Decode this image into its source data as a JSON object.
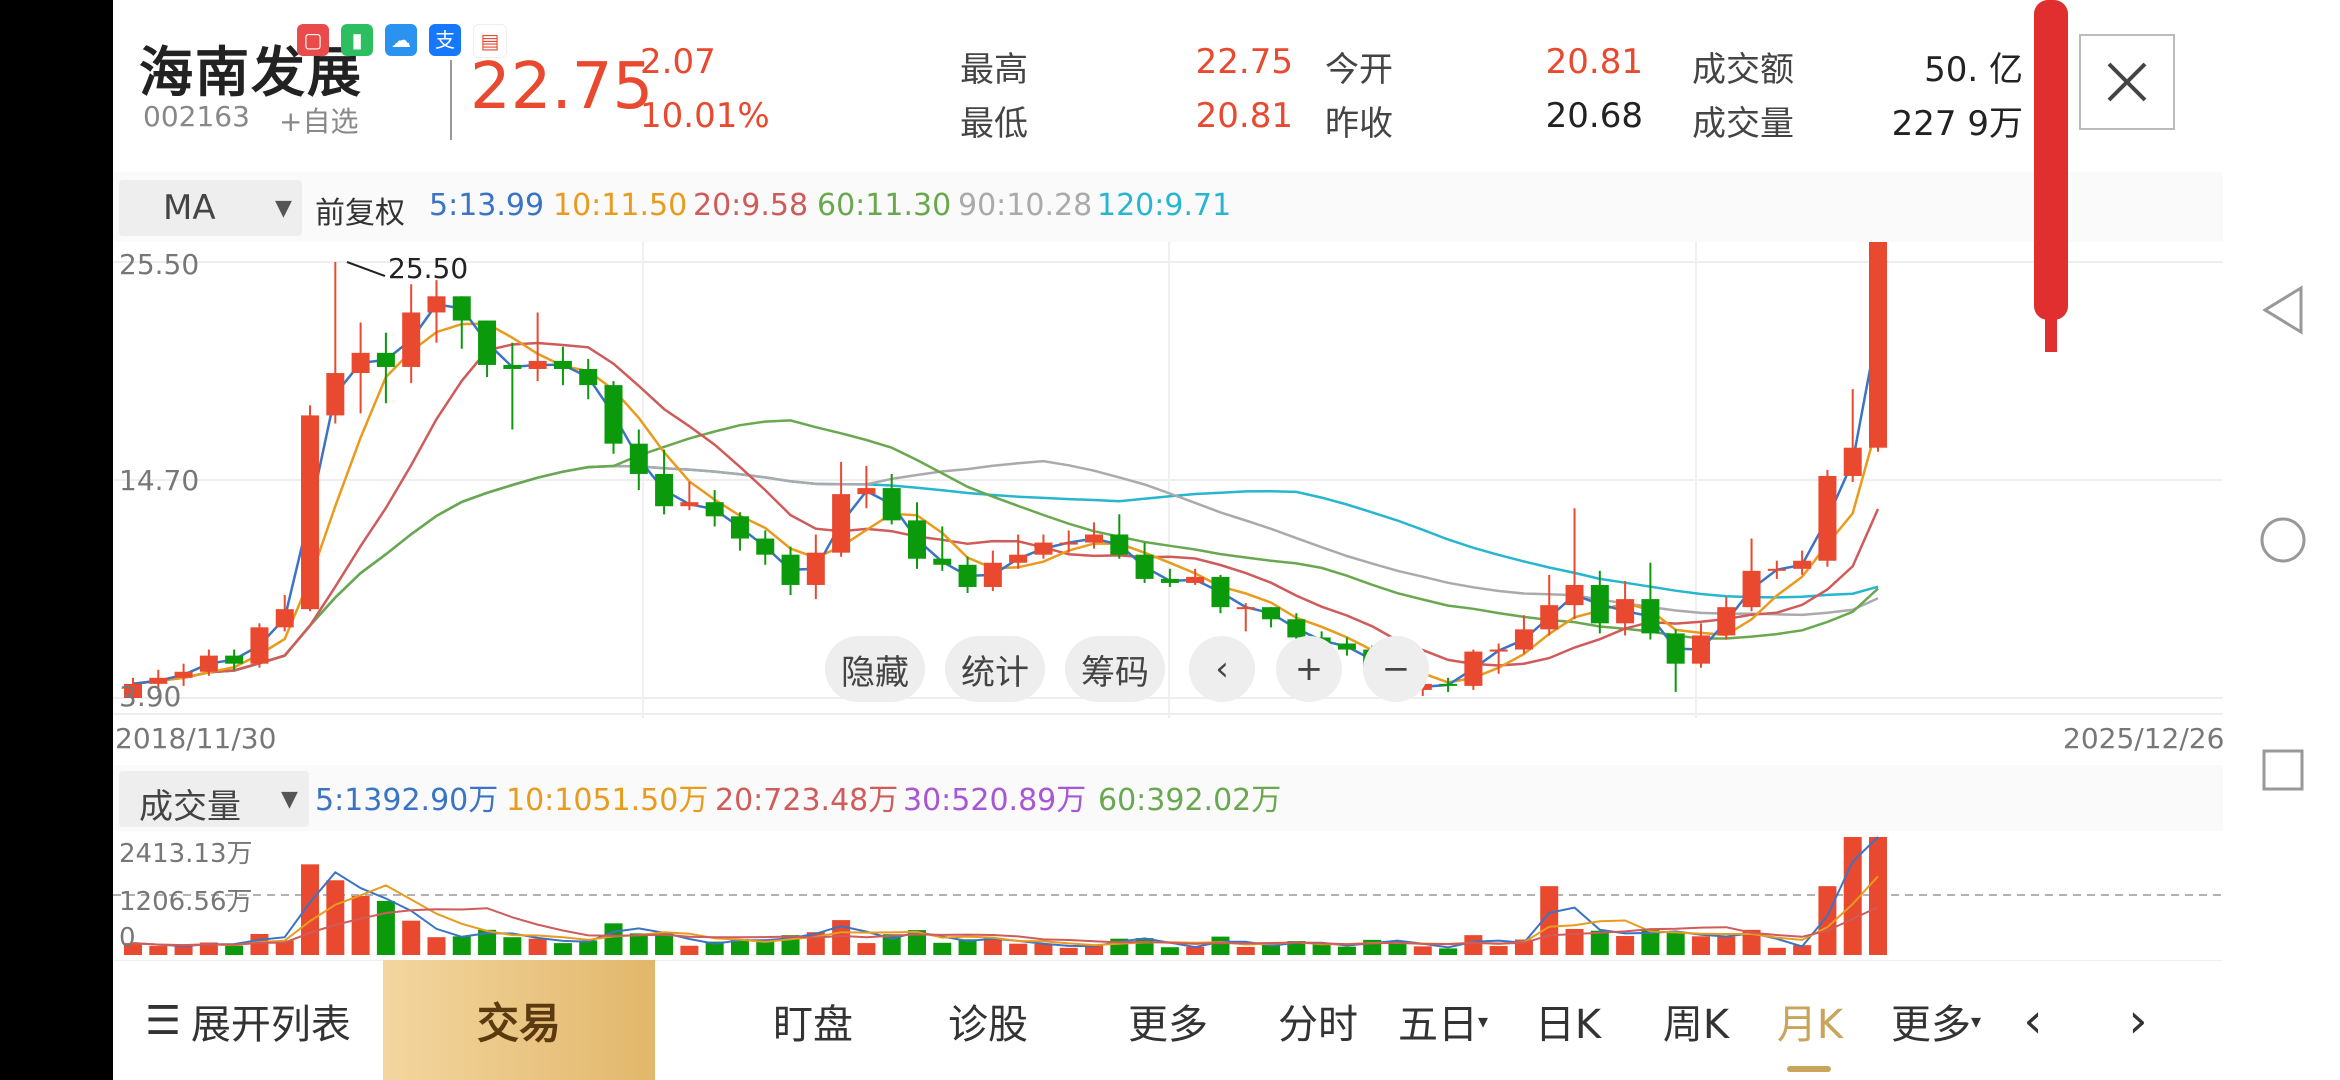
{
  "header": {
    "name": "海南发展",
    "code": "002163",
    "add_fav": "+自选",
    "price": "22.75",
    "change": "2.07",
    "change_pct": "10.01%",
    "high_label": "最高",
    "high_value": "22.75",
    "low_label": "最低",
    "low_value": "20.81",
    "open_label": "今开",
    "open_value": "20.81",
    "prev_label": "昨收",
    "prev_value": "20.68",
    "amount_label": "成交额",
    "amount_value": "50.  亿",
    "volume_label": "成交量",
    "volume_value": "227  9万"
  },
  "indicator": {
    "select": "MA",
    "adjust": "前复权",
    "ma5": "5:13.99",
    "ma10": "10:11.50",
    "ma20": "20:9.58",
    "ma60": "60:11.30",
    "ma90": "90:10.28",
    "ma120": "120:9.71"
  },
  "chart_data": {
    "type": "candlestick",
    "ylabels": [
      "25.50",
      "14.70",
      "3.90"
    ],
    "peak_label": "25.50",
    "start_date": "2018/11/30",
    "end_date": "2025/12/26",
    "candles": [
      [
        3.9,
        4.6,
        3.6,
        4.9
      ],
      [
        4.6,
        4.9,
        4.2,
        5.3
      ],
      [
        4.9,
        5.2,
        4.5,
        5.6
      ],
      [
        5.2,
        6.0,
        5.0,
        6.3
      ],
      [
        6.0,
        5.6,
        5.3,
        6.3
      ],
      [
        5.6,
        7.4,
        5.4,
        7.6
      ],
      [
        7.4,
        8.3,
        7.2,
        9.0
      ],
      [
        8.3,
        17.9,
        8.2,
        18.4
      ],
      [
        17.9,
        20.0,
        17.5,
        25.5
      ],
      [
        20.0,
        21.0,
        18.0,
        22.5
      ],
      [
        21.0,
        20.3,
        18.5,
        22.0
      ],
      [
        20.3,
        23.0,
        19.5,
        24.4
      ],
      [
        23.0,
        23.8,
        21.5,
        24.6
      ],
      [
        23.8,
        22.6,
        21.2,
        23.8
      ],
      [
        22.6,
        20.4,
        19.8,
        22.6
      ],
      [
        20.4,
        20.2,
        17.2,
        21.5
      ],
      [
        20.2,
        20.6,
        19.6,
        23.0
      ],
      [
        20.6,
        20.2,
        19.4,
        21.3
      ],
      [
        20.2,
        19.4,
        18.7,
        20.7
      ],
      [
        19.4,
        16.5,
        16.0,
        19.6
      ],
      [
        16.5,
        15.0,
        14.2,
        17.2
      ],
      [
        15.0,
        13.4,
        13.0,
        16.2
      ],
      [
        13.4,
        13.6,
        13.2,
        14.6
      ],
      [
        13.6,
        12.9,
        12.4,
        14.2
      ],
      [
        12.9,
        11.8,
        11.2,
        13.1
      ],
      [
        11.8,
        11.0,
        10.5,
        12.2
      ],
      [
        11.0,
        9.5,
        9.0,
        11.4
      ],
      [
        9.5,
        11.1,
        8.8,
        12.0
      ],
      [
        11.1,
        14.0,
        10.9,
        15.6
      ],
      [
        14.0,
        14.3,
        13.3,
        15.4
      ],
      [
        14.3,
        12.7,
        12.5,
        15.0
      ],
      [
        12.7,
        10.8,
        10.3,
        13.6
      ],
      [
        10.8,
        10.5,
        10.2,
        12.4
      ],
      [
        10.5,
        9.4,
        9.1,
        10.9
      ],
      [
        9.4,
        10.6,
        9.2,
        11.2
      ],
      [
        10.6,
        11.0,
        10.3,
        12.0
      ],
      [
        11.0,
        11.6,
        10.8,
        12.0
      ],
      [
        11.6,
        11.6,
        11.1,
        12.2
      ],
      [
        11.6,
        12.0,
        11.3,
        12.6
      ],
      [
        12.0,
        11.0,
        10.8,
        13.0
      ],
      [
        11.0,
        9.8,
        9.6,
        11.6
      ],
      [
        9.8,
        9.6,
        9.4,
        10.3
      ],
      [
        9.6,
        9.9,
        9.5,
        10.3
      ],
      [
        9.9,
        8.4,
        8.1,
        10.0
      ],
      [
        8.4,
        8.4,
        7.2,
        8.6
      ],
      [
        8.4,
        7.8,
        7.4,
        8.4
      ],
      [
        7.8,
        6.9,
        6.5,
        8.1
      ],
      [
        6.9,
        6.6,
        5.5,
        7.2
      ],
      [
        6.6,
        6.3,
        6.0,
        6.9
      ],
      [
        6.3,
        5.3,
        4.7,
        6.5
      ],
      [
        5.3,
        4.3,
        4.1,
        5.4
      ],
      [
        4.3,
        4.6,
        4.0,
        5.0
      ],
      [
        4.6,
        4.5,
        4.2,
        4.9
      ],
      [
        4.5,
        6.2,
        4.3,
        6.3
      ],
      [
        6.2,
        6.3,
        5.1,
        6.6
      ],
      [
        6.3,
        7.3,
        6.1,
        8.0
      ],
      [
        7.3,
        8.5,
        7.0,
        10.0
      ],
      [
        8.5,
        9.5,
        7.8,
        13.3
      ],
      [
        9.5,
        7.6,
        7.1,
        10.2
      ],
      [
        7.6,
        8.8,
        7.0,
        9.7
      ],
      [
        8.8,
        7.1,
        6.8,
        10.6
      ],
      [
        7.1,
        5.6,
        4.2,
        7.3
      ],
      [
        5.6,
        7.0,
        5.4,
        7.6
      ],
      [
        7.0,
        8.4,
        6.8,
        8.9
      ],
      [
        8.4,
        10.2,
        8.2,
        11.8
      ],
      [
        10.2,
        10.3,
        9.8,
        10.7
      ],
      [
        10.3,
        10.7,
        10.0,
        11.2
      ],
      [
        10.7,
        14.9,
        10.4,
        15.2
      ],
      [
        14.9,
        16.3,
        14.6,
        19.2
      ],
      [
        16.3,
        28.3,
        16.1,
        28.3
      ]
    ],
    "colors": {
      "up": "#e8492f",
      "down": "#0b9a0b",
      "ma5": "#3b74c4",
      "ma10": "#e89b1c",
      "ma20": "#cf5b5b",
      "ma60": "#6aa84f",
      "ma90": "#aaaaaa",
      "ma120": "#27b6cf"
    }
  },
  "controls": {
    "hide": "隐藏",
    "stats": "统计",
    "chips": "筹码"
  },
  "volume": {
    "select": "成交量",
    "ma5": "5:1392.90万",
    "ma10": "10:1051.50万",
    "ma20": "20:723.48万",
    "ma30": "30:520.89万",
    "ma60": "60:392.02万",
    "ylabels": [
      "2413.13万",
      "1206.56万",
      "0"
    ]
  },
  "tabs": {
    "expand": "展开列表",
    "trade": "交易",
    "watch": "盯盘",
    "diagnose": "诊股",
    "more": "更多",
    "intraday": "分时",
    "five_day": "五日",
    "day_k": "日K",
    "week_k": "周K",
    "month_k": "月K",
    "more2": "更多"
  }
}
